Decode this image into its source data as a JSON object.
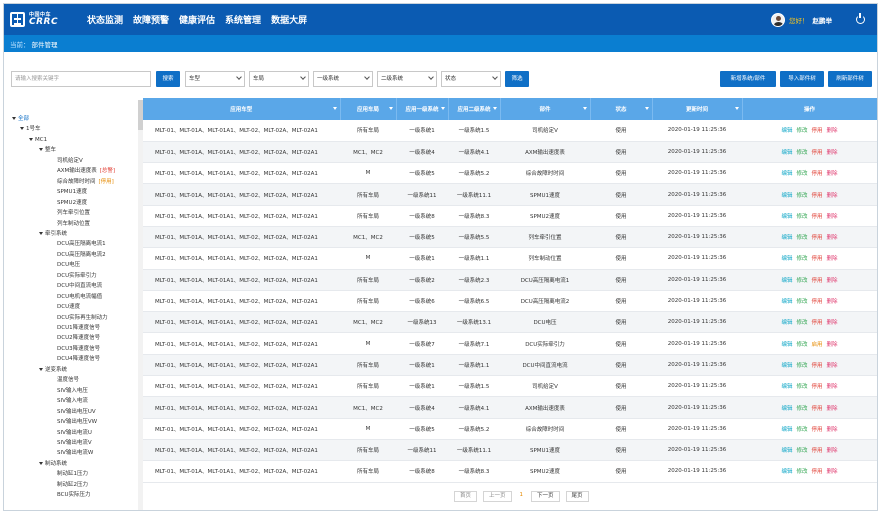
{
  "header": {
    "logo_cn": "中国中车",
    "logo_en": "CRRC",
    "nav": [
      "状态监测",
      "故障预警",
      "健康评估",
      "系统管理",
      "数据大屏"
    ],
    "greeting": "您好！",
    "username": "赵鹏举"
  },
  "breadcrumb": {
    "prefix": "当前：",
    "current": "部件管理"
  },
  "filters": {
    "search_placeholder": "请输入搜索关键字",
    "search_button": "搜索",
    "selects": [
      "车型",
      "车局",
      "一级系统",
      "二级系统",
      "状态"
    ],
    "filter_button": "筛选",
    "actions": [
      "新增系统/部件",
      "导入部件树",
      "刷新部件树"
    ]
  },
  "tree": {
    "items": [
      {
        "label": "全部",
        "level": 0,
        "expanded": true,
        "root": true
      },
      {
        "label": "1号车",
        "level": 1,
        "expanded": true
      },
      {
        "label": "MC1",
        "level": 2,
        "expanded": true
      },
      {
        "label": "整车",
        "level": 3,
        "expanded": true
      },
      {
        "label": "司机给定V",
        "level": 4
      },
      {
        "label": "AXM输出速度表",
        "level": 4,
        "tag": "[总警]",
        "tag_color": "red"
      },
      {
        "label": "综合故障时时间",
        "level": 4,
        "tag": "[停用]",
        "tag_color": "orange"
      },
      {
        "label": "SPMU1速度",
        "level": 4
      },
      {
        "label": "SPMU2速度",
        "level": 4
      },
      {
        "label": "列车牵引位置",
        "level": 4
      },
      {
        "label": "列车制动位置",
        "level": 4
      },
      {
        "label": "牵引系统",
        "level": 3,
        "expanded": true
      },
      {
        "label": "DCU高压隔离电流1",
        "level": 4
      },
      {
        "label": "DCU高压隔离电流2",
        "level": 4
      },
      {
        "label": "DCU电压",
        "level": 4
      },
      {
        "label": "DCU实际牵引力",
        "level": 4
      },
      {
        "label": "DCU中间直流电流",
        "level": 4
      },
      {
        "label": "DCU电机电流幅值",
        "level": 4
      },
      {
        "label": "DCU速度",
        "level": 4
      },
      {
        "label": "DCU实际再生制动力",
        "level": 4
      },
      {
        "label": "DCU1降速度信号",
        "level": 4
      },
      {
        "label": "DCU2降速度信号",
        "level": 4
      },
      {
        "label": "DCU3降速度信号",
        "level": 4
      },
      {
        "label": "DCU4降速度信号",
        "level": 4
      },
      {
        "label": "逆变系统",
        "level": 3,
        "expanded": true
      },
      {
        "label": "温度信号",
        "level": 4
      },
      {
        "label": "SIV输入电压",
        "level": 4
      },
      {
        "label": "SIV输入电流",
        "level": 4
      },
      {
        "label": "SIV输出电压UV",
        "level": 4
      },
      {
        "label": "SIV输出电压VW",
        "level": 4
      },
      {
        "label": "SIV输出电流U",
        "level": 4
      },
      {
        "label": "SIV输出电流V",
        "level": 4
      },
      {
        "label": "SIV输出电流W",
        "level": 4
      },
      {
        "label": "制动系统",
        "level": 3,
        "expanded": true
      },
      {
        "label": "制动缸1压力",
        "level": 4
      },
      {
        "label": "制动缸2压力",
        "level": 4
      },
      {
        "label": "BCU实际压力",
        "level": 4
      }
    ]
  },
  "table": {
    "columns": [
      "应用车型",
      "应用车局",
      "应用一级系统",
      "应用二级系统",
      "部件",
      "状态",
      "更新时间",
      "操作"
    ],
    "trains": "MLT-01、MLT-01A、MLT-01A1、MLT-02、MLT-02A、MLT-02A1",
    "ops": {
      "edit": "编辑",
      "modify": "修改",
      "stop": "停用",
      "start": "启用",
      "delete": "删除"
    },
    "rows": [
      {
        "trains": "MLT-01、MLT-01A、MLT-01A1、MLT-02、MLT-02A、MLT-02A1",
        "bureau": "所有车局",
        "sys1": "一级系统1",
        "sys2": "一级系统1.5",
        "part": "司机给定V",
        "status": "使用",
        "time": "2020-01-19 11:25:36",
        "third": "停用"
      },
      {
        "trains": "MLT-01、MLT-01A、MLT-01A1、MLT-02、MLT-02A、MLT-02A1",
        "bureau": "MC1、MC2",
        "sys1": "一级系统4",
        "sys2": "一级系统4.1",
        "part": "AXM输出速度表",
        "status": "使用",
        "time": "2020-01-19 11:25:36",
        "third": "停用"
      },
      {
        "trains": "MLT-01、MLT-01A、MLT-01A1、MLT-02、MLT-02A、MLT-02A1",
        "bureau": "M",
        "sys1": "一级系统5",
        "sys2": "一级系统5.2",
        "part": "综合故障时时间",
        "status": "使用",
        "time": "2020-01-19 11:25:36",
        "third": "停用"
      },
      {
        "trains": "MLT-01、MLT-01A、MLT-01A1、MLT-02、MLT-02A、MLT-02A1",
        "bureau": "所有车局",
        "sys1": "一级系统11",
        "sys2": "一级系统11.1",
        "part": "SPMU1速度",
        "status": "使用",
        "time": "2020-01-19 11:25:36",
        "third": "停用"
      },
      {
        "trains": "MLT-01、MLT-01A、MLT-01A1、MLT-02、MLT-02A、MLT-02A1",
        "bureau": "所有车局",
        "sys1": "一级系统8",
        "sys2": "一级系统8.3",
        "part": "SPMU2速度",
        "status": "使用",
        "time": "2020-01-19 11:25:36",
        "third": "停用"
      },
      {
        "trains": "MLT-01、MLT-01A、MLT-01A1、MLT-02、MLT-02A、MLT-02A1",
        "bureau": "MC1、MC2",
        "sys1": "一级系统5",
        "sys2": "一级系统5.5",
        "part": "列车牵引位置",
        "status": "使用",
        "time": "2020-01-19 11:25:36",
        "third": "停用"
      },
      {
        "trains": "MLT-01、MLT-01A、MLT-01A1、MLT-02、MLT-02A、MLT-02A1",
        "bureau": "M",
        "sys1": "一级系统1",
        "sys2": "一级系统1.1",
        "part": "列车制动位置",
        "status": "使用",
        "time": "2020-01-19 11:25:36",
        "third": "停用"
      },
      {
        "trains": "MLT-01、MLT-01A、MLT-01A1、MLT-02、MLT-02A、MLT-02A1",
        "bureau": "所有车局",
        "sys1": "一级系统2",
        "sys2": "一级系统2.3",
        "part": "DCU高压隔离电流1",
        "status": "使用",
        "time": "2020-01-19 11:25:36",
        "third": "停用"
      },
      {
        "trains": "MLT-01、MLT-01A、MLT-01A1、MLT-02、MLT-02A、MLT-02A1",
        "bureau": "所有车局",
        "sys1": "一级系统6",
        "sys2": "一级系统6.5",
        "part": "DCU高压隔离电流2",
        "status": "使用",
        "time": "2020-01-19 11:25:36",
        "third": "停用"
      },
      {
        "trains": "MLT-01、MLT-01A、MLT-01A1、MLT-02、MLT-02A、MLT-02A1",
        "bureau": "MC1、MC2",
        "sys1": "一级系统13",
        "sys2": "一级系统13.1",
        "part": "DCU电压",
        "status": "使用",
        "time": "2020-01-19 11:25:36",
        "third": "停用"
      },
      {
        "trains": "MLT-01、MLT-01A、MLT-01A1、MLT-02、MLT-02A、MLT-02A1",
        "bureau": "M",
        "sys1": "一级系统7",
        "sys2": "一级系统7.1",
        "part": "DCU实际牵引力",
        "status": "使用",
        "time": "2020-01-19 11:25:36",
        "third": "启用"
      },
      {
        "trains": "MLT-01、MLT-01A、MLT-01A1、MLT-02、MLT-02A、MLT-02A1",
        "bureau": "所有车局",
        "sys1": "一级系统1",
        "sys2": "一级系统1.1",
        "part": "DCU中间直流电流",
        "status": "使用",
        "time": "2020-01-19 11:25:36",
        "third": "停用"
      },
      {
        "trains": "MLT-01、MLT-01A、MLT-01A1、MLT-02、MLT-02A、MLT-02A1",
        "bureau": "所有车局",
        "sys1": "一级系统1",
        "sys2": "一级系统1.5",
        "part": "司机给定V",
        "status": "使用",
        "time": "2020-01-19 11:25:36",
        "third": "停用"
      },
      {
        "trains": "MLT-01、MLT-01A、MLT-01A1、MLT-02、MLT-02A、MLT-02A1",
        "bureau": "MC1、MC2",
        "sys1": "一级系统4",
        "sys2": "一级系统4.1",
        "part": "AXM输出速度表",
        "status": "使用",
        "time": "2020-01-19 11:25:36",
        "third": "停用"
      },
      {
        "trains": "MLT-01、MLT-01A、MLT-01A1、MLT-02、MLT-02A、MLT-02A1",
        "bureau": "M",
        "sys1": "一级系统5",
        "sys2": "一级系统5.2",
        "part": "综合故障时时间",
        "status": "使用",
        "time": "2020-01-19 11:25:36",
        "third": "停用"
      },
      {
        "trains": "MLT-01、MLT-01A、MLT-01A1、MLT-02、MLT-02A、MLT-02A1",
        "bureau": "所有车局",
        "sys1": "一级系统11",
        "sys2": "一级系统11.1",
        "part": "SPMU1速度",
        "status": "使用",
        "time": "2020-01-19 11:25:36",
        "third": "停用"
      },
      {
        "trains": "MLT-01、MLT-01A、MLT-01A1、MLT-02、MLT-02A、MLT-02A1",
        "bureau": "所有车局",
        "sys1": "一级系统8",
        "sys2": "一级系统8.3",
        "part": "SPMU2速度",
        "status": "使用",
        "time": "2020-01-19 11:25:36",
        "third": "停用"
      }
    ]
  },
  "pager": {
    "first": "首页",
    "prev": "上一页",
    "current": "1",
    "next": "下一页",
    "last": "尾页"
  },
  "colors": {
    "header": "#0b5bb2",
    "crumb": "#0a7ed1",
    "table_header": "#5aa7e8",
    "button": "#0f6fc6"
  }
}
